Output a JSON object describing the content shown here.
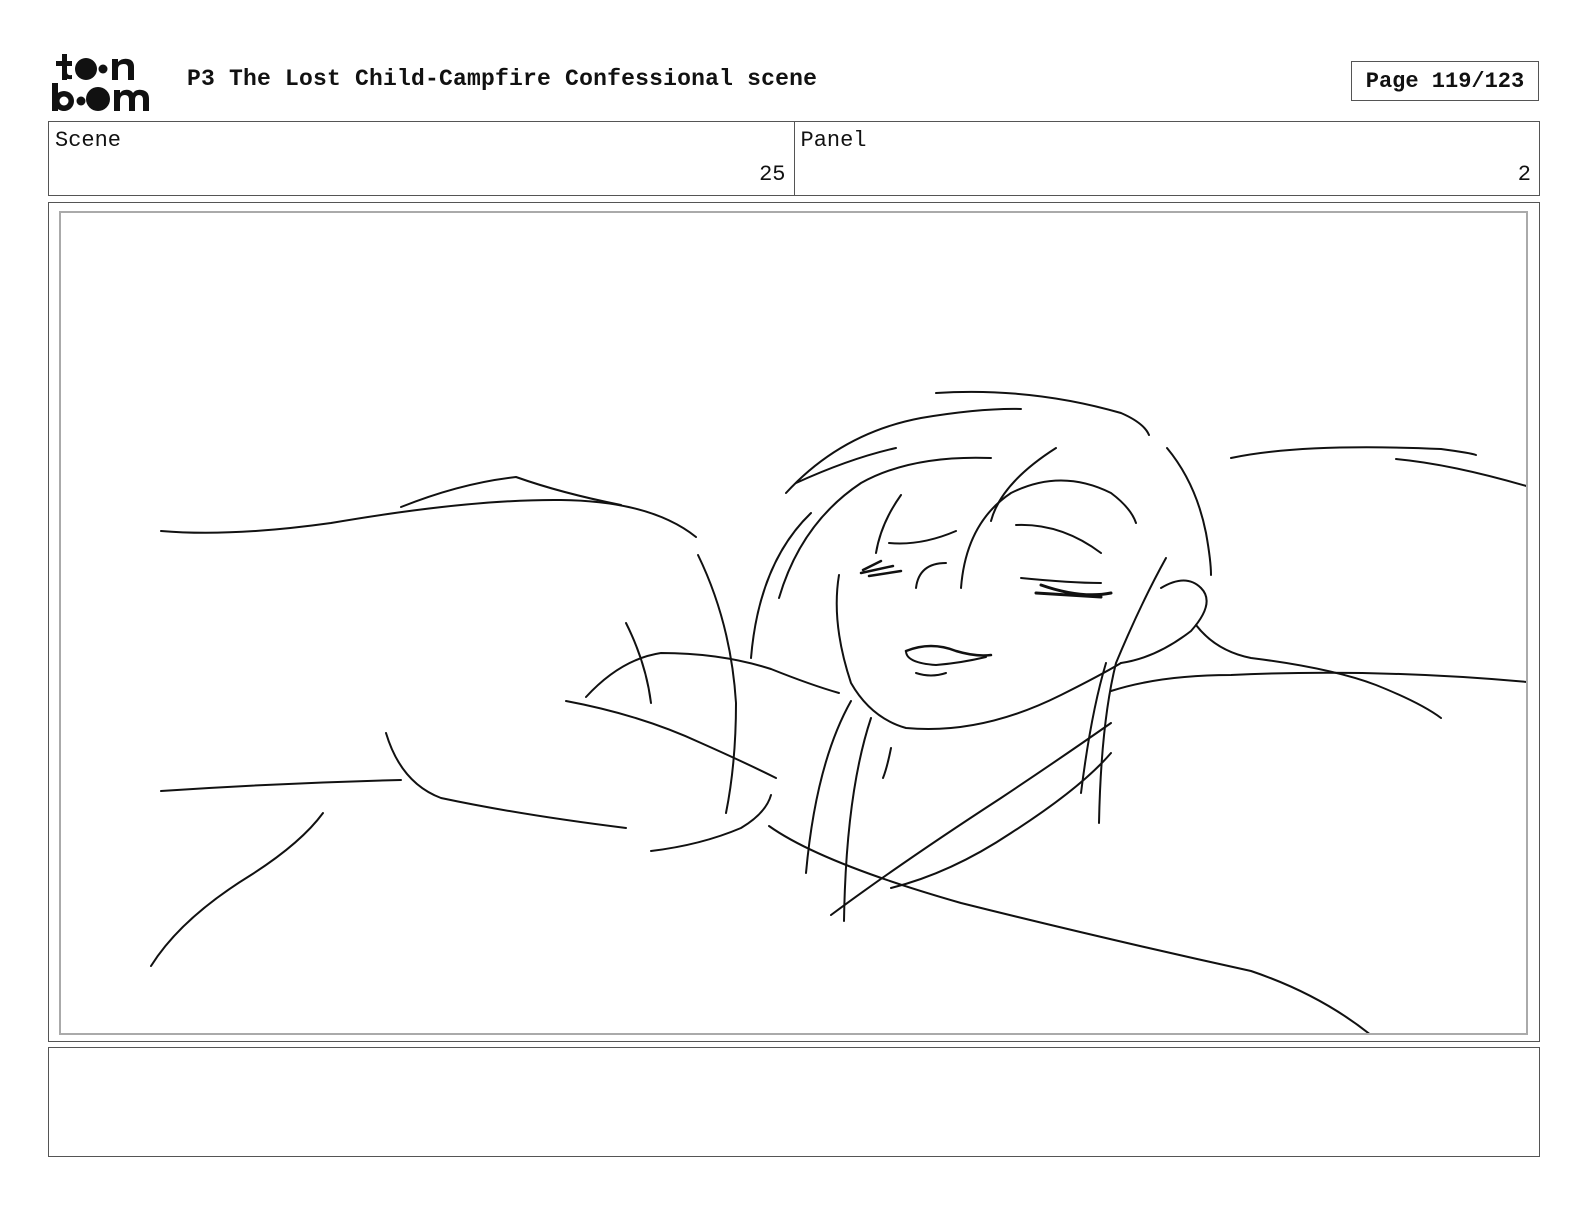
{
  "header": {
    "logo_text": "toon boom",
    "title": "P3 The Lost Child-Campfire Confessional scene",
    "page_label": "Page 119/123"
  },
  "info": {
    "scene_label": "Scene",
    "scene_value": "25",
    "panel_label": "Panel",
    "panel_value": "2"
  },
  "drawing": {
    "description_icon": "sketch-sleeping-character"
  },
  "notes": {
    "text": ""
  }
}
